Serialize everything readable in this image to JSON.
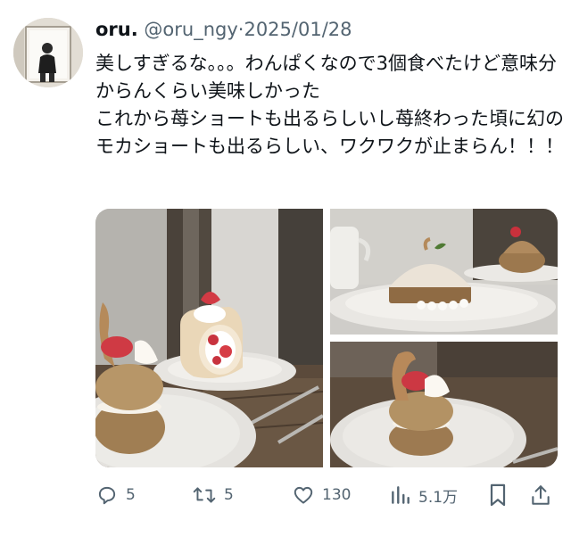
{
  "tweet": {
    "display_name": "oru.",
    "handle": "@oru_ngy",
    "separator": "·",
    "date": "2025/01/28",
    "text": "美しすぎるな。。。わんぱくなので3個食べたけど意味分からんくらい美味しかった\nこれから苺ショートも出るらしいし苺終わった頃に幻のモカショートも出るらしい、ワクワクが止まらん！！！"
  },
  "media": {
    "photos": [
      {
        "name": "strawberry-roll-cake-and-swan-puff-photo"
      },
      {
        "name": "dome-cake-photo"
      },
      {
        "name": "swan-cream-puff-photo"
      }
    ]
  },
  "actions": {
    "reply_count": "5",
    "retweet_count": "5",
    "like_count": "130",
    "view_count": "5.1万",
    "icons": [
      "reply-icon",
      "retweet-icon",
      "like-icon",
      "views-icon",
      "bookmark-icon",
      "share-icon"
    ]
  }
}
